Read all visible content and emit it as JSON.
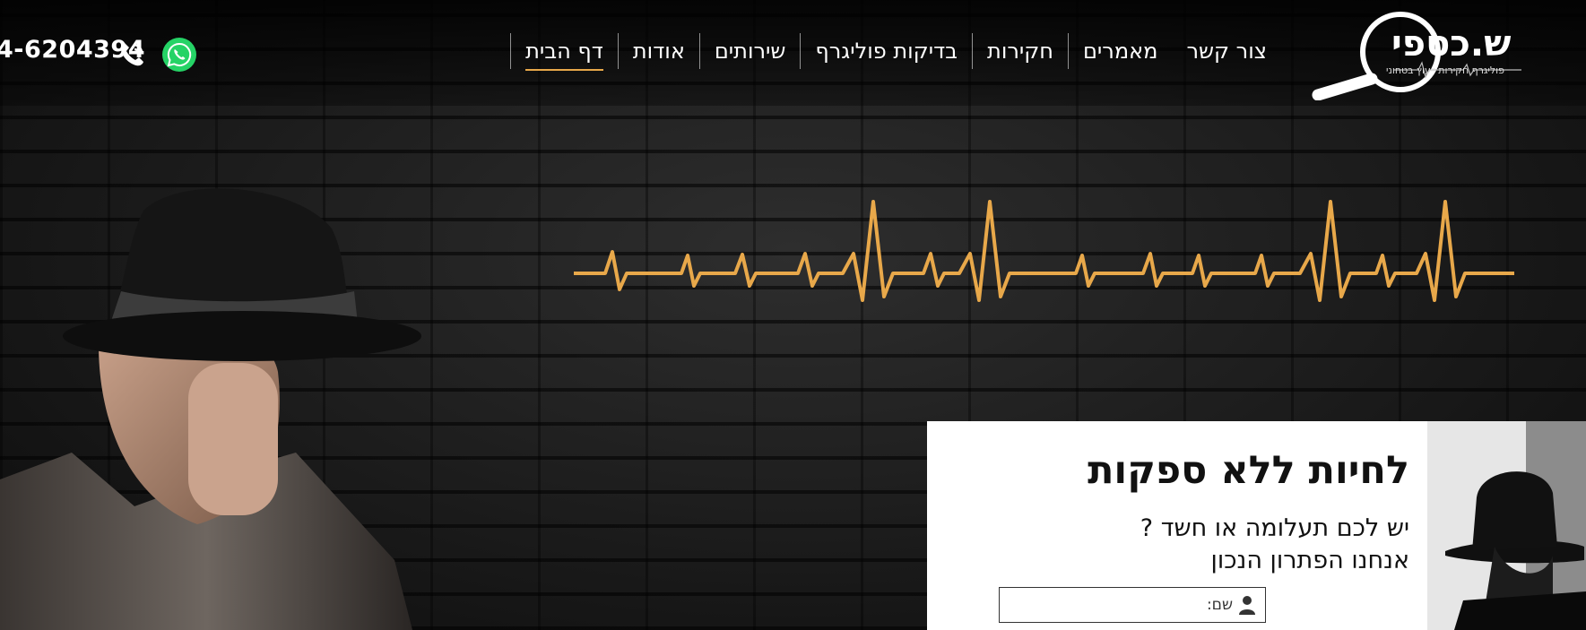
{
  "header": {
    "phone": "4-6204394",
    "nav": [
      {
        "label": "דף הבית",
        "active": true
      },
      {
        "label": "אודות",
        "active": false
      },
      {
        "label": "שירותים",
        "active": false
      },
      {
        "label": "בדיקות פוליגרף",
        "active": false
      },
      {
        "label": "חקירות",
        "active": false
      },
      {
        "label": "מאמרים",
        "active": false
      },
      {
        "label": "צור קשר",
        "active": false
      }
    ],
    "logo": {
      "name": "ש.כספי",
      "tagline": "פוליגרף חקירות ייעוץ בטחוני"
    }
  },
  "colors": {
    "accent": "#e8a84a",
    "whatsapp": "#25d366"
  },
  "form": {
    "title": "לחיות ללא ספקות",
    "subtitle_line1": "יש לכם תעלומה או חשד ?",
    "subtitle_line2": "אנחנו הפתרון הנכון",
    "name_label": "שם:"
  }
}
